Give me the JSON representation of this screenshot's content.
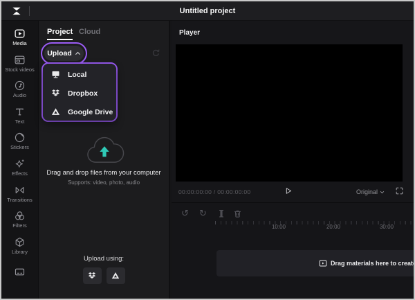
{
  "colors": {
    "accent": "#9b5cf6",
    "teal": "#2fc9b6"
  },
  "topbar": {
    "title": "Untitled project",
    "logo": "capcut-logo"
  },
  "sidebar": {
    "items": [
      {
        "label": "Media",
        "icon": "media-icon",
        "active": true
      },
      {
        "label": "Stock videos",
        "icon": "stock-videos-icon",
        "active": false
      },
      {
        "label": "Audio",
        "icon": "audio-icon",
        "active": false
      },
      {
        "label": "Text",
        "icon": "text-icon",
        "active": false
      },
      {
        "label": "Stickers",
        "icon": "stickers-icon",
        "active": false
      },
      {
        "label": "Effects",
        "icon": "effects-icon",
        "active": false
      },
      {
        "label": "Transitions",
        "icon": "transitions-icon",
        "active": false
      },
      {
        "label": "Filters",
        "icon": "filters-icon",
        "active": false
      },
      {
        "label": "Library",
        "icon": "library-icon",
        "active": false
      },
      {
        "label": "",
        "icon": "captions-icon",
        "active": false
      }
    ]
  },
  "media_panel": {
    "tabs": [
      {
        "label": "Project",
        "active": true
      },
      {
        "label": "Cloud",
        "active": false
      }
    ],
    "upload_button_label": "Upload",
    "upload_menu": [
      {
        "label": "Local",
        "icon": "monitor-icon"
      },
      {
        "label": "Dropbox",
        "icon": "dropbox-icon"
      },
      {
        "label": "Google Drive",
        "icon": "google-drive-icon"
      }
    ],
    "dropzone": {
      "title": "Drag and drop files from your computer",
      "subtitle": "Supports: video, photo, audio"
    },
    "upload_using_label": "Upload using:"
  },
  "player": {
    "title": "Player",
    "timecode_display": "00:00:00:00 / 00:00:00:00",
    "resolution_label": "Original"
  },
  "timeline": {
    "ruler_labels": [
      "10:00",
      "20:00",
      "30:00"
    ],
    "drop_hint": "Drag materials here to create fantas"
  }
}
